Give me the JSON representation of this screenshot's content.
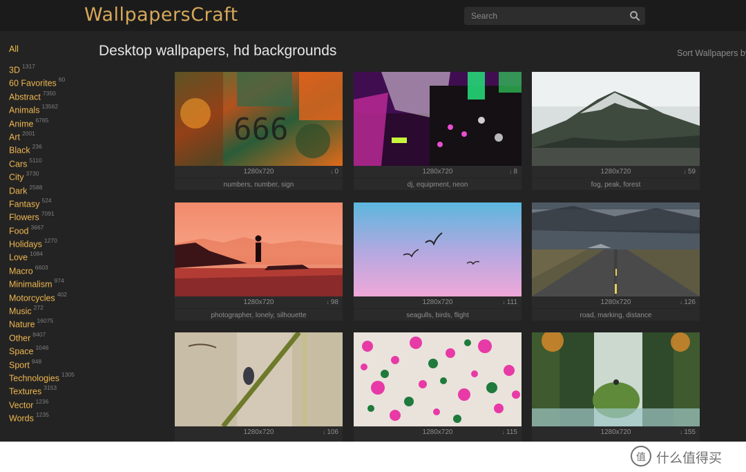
{
  "header": {
    "logo": "WallpapersCraft",
    "search_placeholder": "Search",
    "search_icon": "search-icon"
  },
  "sidebar": {
    "all_label": "All",
    "categories": [
      {
        "name": "3D",
        "count": "1317"
      },
      {
        "name": "60 Favorites",
        "count": "60"
      },
      {
        "name": "Abstract",
        "count": "7350"
      },
      {
        "name": "Animals",
        "count": "13562"
      },
      {
        "name": "Anime",
        "count": "6765"
      },
      {
        "name": "Art",
        "count": "2001"
      },
      {
        "name": "Black",
        "count": "236"
      },
      {
        "name": "Cars",
        "count": "5110"
      },
      {
        "name": "City",
        "count": "3730"
      },
      {
        "name": "Dark",
        "count": "2588"
      },
      {
        "name": "Fantasy",
        "count": "524"
      },
      {
        "name": "Flowers",
        "count": "7091"
      },
      {
        "name": "Food",
        "count": "3667"
      },
      {
        "name": "Holidays",
        "count": "1270"
      },
      {
        "name": "Love",
        "count": "1084"
      },
      {
        "name": "Macro",
        "count": "6603"
      },
      {
        "name": "Minimalism",
        "count": "974"
      },
      {
        "name": "Motorcycles",
        "count": "402"
      },
      {
        "name": "Music",
        "count": "272"
      },
      {
        "name": "Nature",
        "count": "16075"
      },
      {
        "name": "Other",
        "count": "8407"
      },
      {
        "name": "Space",
        "count": "1046"
      },
      {
        "name": "Sport",
        "count": "948"
      },
      {
        "name": "Technologies",
        "count": "1305"
      },
      {
        "name": "Textures",
        "count": "3153"
      },
      {
        "name": "Vector",
        "count": "1236"
      },
      {
        "name": "Words",
        "count": "1235"
      }
    ]
  },
  "main": {
    "title": "Desktop wallpapers, hd backgrounds",
    "sort_label": "Sort Wallpapers by",
    "wallpapers": [
      {
        "resolution": "1280x720",
        "downloads": "0",
        "tags": "numbers, number, sign",
        "thumb_text": "666"
      },
      {
        "resolution": "1280x720",
        "downloads": "8",
        "tags": "dj, equipment, neon"
      },
      {
        "resolution": "1280x720",
        "downloads": "59",
        "tags": "fog, peak, forest"
      },
      {
        "resolution": "1280x720",
        "downloads": "98",
        "tags": "photographer, lonely, silhouette"
      },
      {
        "resolution": "1280x720",
        "downloads": "111",
        "tags": "seagulls, birds, flight"
      },
      {
        "resolution": "1280x720",
        "downloads": "126",
        "tags": "road, marking, distance"
      },
      {
        "resolution": "1280x720",
        "downloads": "106",
        "tags": ""
      },
      {
        "resolution": "1280x720",
        "downloads": "115",
        "tags": ""
      },
      {
        "resolution": "1280x720",
        "downloads": "155",
        "tags": ""
      }
    ]
  },
  "watermark": {
    "text": "什么值得买"
  },
  "colors": {
    "accent": "#f0b750",
    "logo": "#d7a85a",
    "background": "#232323",
    "header": "#1b1b1b"
  }
}
